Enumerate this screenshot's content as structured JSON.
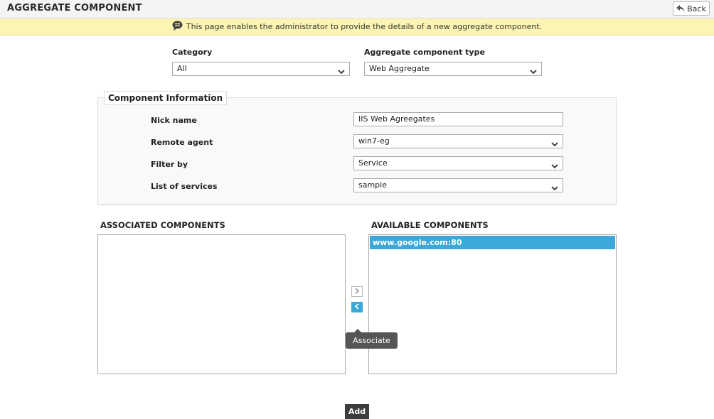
{
  "header": {
    "title": "AGGREGATE COMPONENT",
    "back_label": "Back"
  },
  "info_bar": {
    "message": "This page enables the administrator to provide the details of a new aggregate component."
  },
  "category": {
    "label": "Category",
    "value": "All"
  },
  "component_type": {
    "label": "Aggregate component type",
    "value": "Web Aggregate"
  },
  "component_info": {
    "legend": "Component Information",
    "nick_name": {
      "label": "Nick name",
      "value": "IIS Web Agreegates"
    },
    "remote_agent": {
      "label": "Remote agent",
      "value": "win7-eg"
    },
    "filter_by": {
      "label": "Filter by",
      "value": "Service"
    },
    "list_of_services": {
      "label": "List of services",
      "value": "sample"
    }
  },
  "associated": {
    "heading": "ASSOCIATED COMPONENTS",
    "items": []
  },
  "available": {
    "heading": "AVAILABLE COMPONENTS",
    "items": [
      "www.google.com:80"
    ]
  },
  "tooltip": {
    "text": "Associate"
  },
  "add_label": "Add",
  "colors": {
    "info_bar_bg": "#fbf4b2",
    "selection_blue": "#3aa8d8",
    "dark_button": "#3d3d3d"
  },
  "icons": {
    "back": "back-arrow-icon",
    "info": "speech-bubble-icon",
    "dropdown": "chevron-down-icon",
    "move_right": "chevron-right-icon",
    "move_left": "chevron-left-icon"
  }
}
